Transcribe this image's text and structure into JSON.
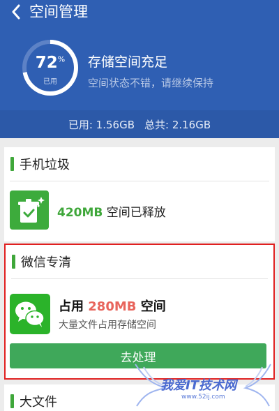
{
  "header": {
    "title": "空间管理",
    "ring": {
      "percent": "72",
      "percent_sign": "%",
      "used_label": "已用",
      "fraction": 0.72
    },
    "status_title": "存储空间充足",
    "status_sub": "空间状态不错，请继续保持",
    "usage_used": "已用: 1.56GB",
    "usage_total": "总共: 2.16GB"
  },
  "junk": {
    "title": "手机垃圾",
    "amount": "420MB",
    "released_text": " 空间已释放"
  },
  "wechat": {
    "title": "微信专清",
    "occupy_prefix": "占用 ",
    "amount": "280MB",
    "occupy_suffix": " 空间",
    "desc": "大量文件占用存储空间",
    "button": "去处理"
  },
  "bigfile": {
    "title": "大文件"
  },
  "watermark": {
    "text": "我爱IT技术网",
    "url": "www.52ij.com"
  },
  "colors": {
    "header_bg": "#2f5fb3",
    "accent_green": "#3fa73a",
    "highlight_red": "#e02020"
  }
}
